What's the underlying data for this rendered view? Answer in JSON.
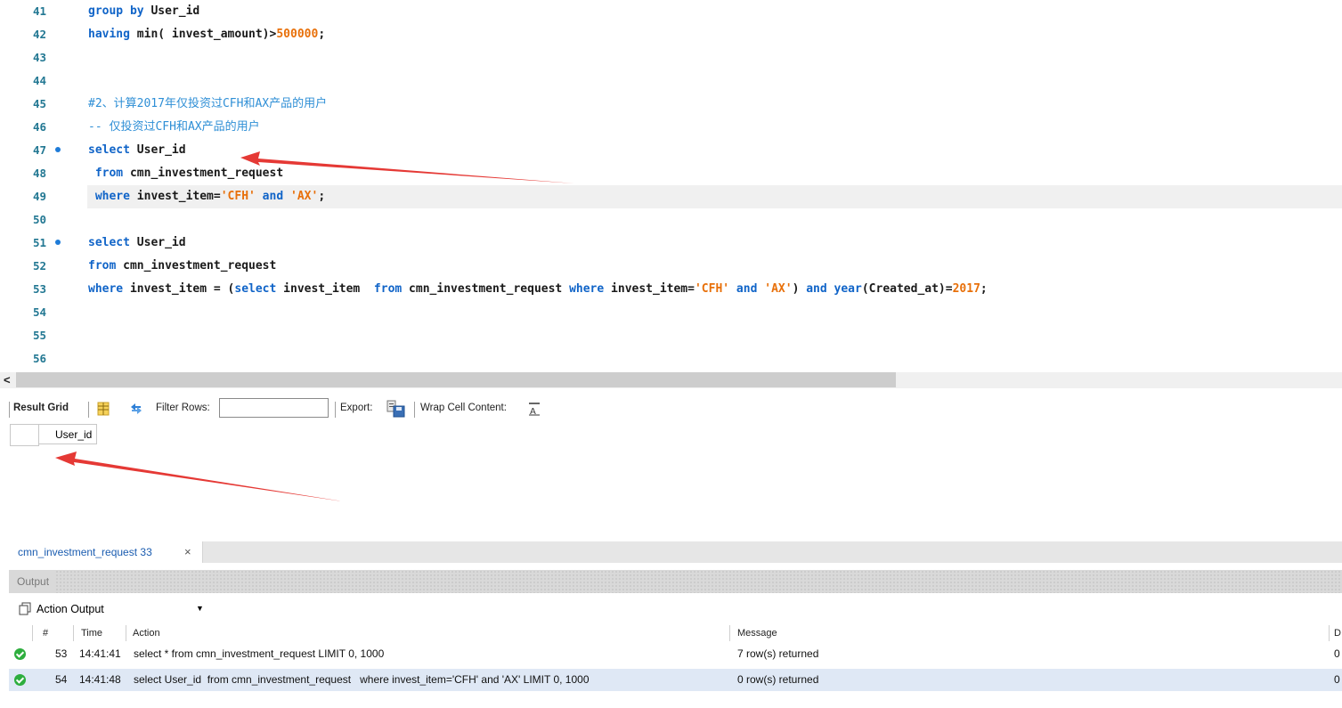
{
  "editor": {
    "lines": [
      {
        "num": "41",
        "dot": false,
        "segments": [
          {
            "t": "group by",
            "c": "kw"
          },
          {
            "t": " User_id",
            "c": ""
          }
        ]
      },
      {
        "num": "42",
        "dot": false,
        "segments": [
          {
            "t": "having",
            "c": "kw"
          },
          {
            "t": " min( invest_amount)>",
            "c": ""
          },
          {
            "t": "500000",
            "c": "num"
          },
          {
            "t": ";",
            "c": ""
          }
        ]
      },
      {
        "num": "43",
        "dot": false,
        "segments": []
      },
      {
        "num": "44",
        "dot": false,
        "segments": []
      },
      {
        "num": "45",
        "dot": false,
        "segments": [
          {
            "t": "#2、计算2017年仅投资过CFH和AX产品的用户",
            "c": "cmt"
          }
        ]
      },
      {
        "num": "46",
        "dot": false,
        "segments": [
          {
            "t": "-- 仅投资过CFH和AX产品的用户",
            "c": "cmt"
          }
        ]
      },
      {
        "num": "47",
        "dot": true,
        "segments": [
          {
            "t": "select",
            "c": "kw"
          },
          {
            "t": " User_id",
            "c": ""
          }
        ]
      },
      {
        "num": "48",
        "dot": false,
        "segments": [
          {
            "t": " from",
            "c": "kw"
          },
          {
            "t": " cmn_investment_request",
            "c": ""
          }
        ]
      },
      {
        "num": "49",
        "dot": false,
        "highlight": true,
        "segments": [
          {
            "t": " where",
            "c": "kw"
          },
          {
            "t": " invest_item=",
            "c": ""
          },
          {
            "t": "'CFH'",
            "c": "str"
          },
          {
            "t": " and",
            "c": "kw"
          },
          {
            "t": " ",
            "c": ""
          },
          {
            "t": "'AX'",
            "c": "str"
          },
          {
            "t": ";",
            "c": ""
          }
        ]
      },
      {
        "num": "50",
        "dot": false,
        "segments": []
      },
      {
        "num": "51",
        "dot": true,
        "segments": [
          {
            "t": "select",
            "c": "kw"
          },
          {
            "t": " User_id",
            "c": ""
          }
        ]
      },
      {
        "num": "52",
        "dot": false,
        "segments": [
          {
            "t": "from",
            "c": "kw"
          },
          {
            "t": " cmn_investment_request",
            "c": ""
          }
        ]
      },
      {
        "num": "53",
        "dot": false,
        "segments": [
          {
            "t": "where",
            "c": "kw"
          },
          {
            "t": " invest_item = (",
            "c": ""
          },
          {
            "t": "select",
            "c": "kw"
          },
          {
            "t": " invest_item  ",
            "c": ""
          },
          {
            "t": "from",
            "c": "kw"
          },
          {
            "t": " cmn_investment_request ",
            "c": ""
          },
          {
            "t": "where",
            "c": "kw"
          },
          {
            "t": " invest_item=",
            "c": ""
          },
          {
            "t": "'CFH'",
            "c": "str"
          },
          {
            "t": " and",
            "c": "kw"
          },
          {
            "t": " ",
            "c": ""
          },
          {
            "t": "'AX'",
            "c": "str"
          },
          {
            "t": ") ",
            "c": ""
          },
          {
            "t": "and",
            "c": "kw"
          },
          {
            "t": " ",
            "c": ""
          },
          {
            "t": "year",
            "c": "kw"
          },
          {
            "t": "(Created_at)=",
            "c": ""
          },
          {
            "t": "2017",
            "c": "num"
          },
          {
            "t": ";",
            "c": ""
          }
        ]
      },
      {
        "num": "54",
        "dot": false,
        "segments": []
      },
      {
        "num": "55",
        "dot": false,
        "segments": []
      },
      {
        "num": "56",
        "dot": false,
        "segments": []
      }
    ],
    "scroll_left_glyph": "<"
  },
  "result_toolbar": {
    "result_grid_label": "Result Grid",
    "filter_rows_label": "Filter Rows:",
    "filter_value": "",
    "export_label": "Export:",
    "wrap_label": "Wrap Cell Content:"
  },
  "grid": {
    "columns": [
      "User_id"
    ]
  },
  "result_tab": {
    "label": "cmn_investment_request 33",
    "close": "×"
  },
  "output": {
    "title": "Output",
    "selector": "Action Output",
    "headers": {
      "num": "#",
      "time": "Time",
      "action": "Action",
      "message": "Message",
      "duration": "D"
    },
    "rows": [
      {
        "num": "53",
        "time": "14:41:41",
        "action": "select * from cmn_investment_request LIMIT 0, 1000",
        "message": "7 row(s) returned",
        "duration": "0",
        "selected": false
      },
      {
        "num": "54",
        "time": "14:41:48",
        "action": "select User_id  from cmn_investment_request   where invest_item='CFH' and 'AX' LIMIT 0, 1000",
        "message": "0 row(s) returned",
        "duration": "0",
        "selected": true
      }
    ]
  },
  "colors": {
    "annotation_arrow": "#e53935",
    "keyword": "#1064c8",
    "string": "#e8700a",
    "comment": "#2f8fd6",
    "line_number": "#237893"
  }
}
